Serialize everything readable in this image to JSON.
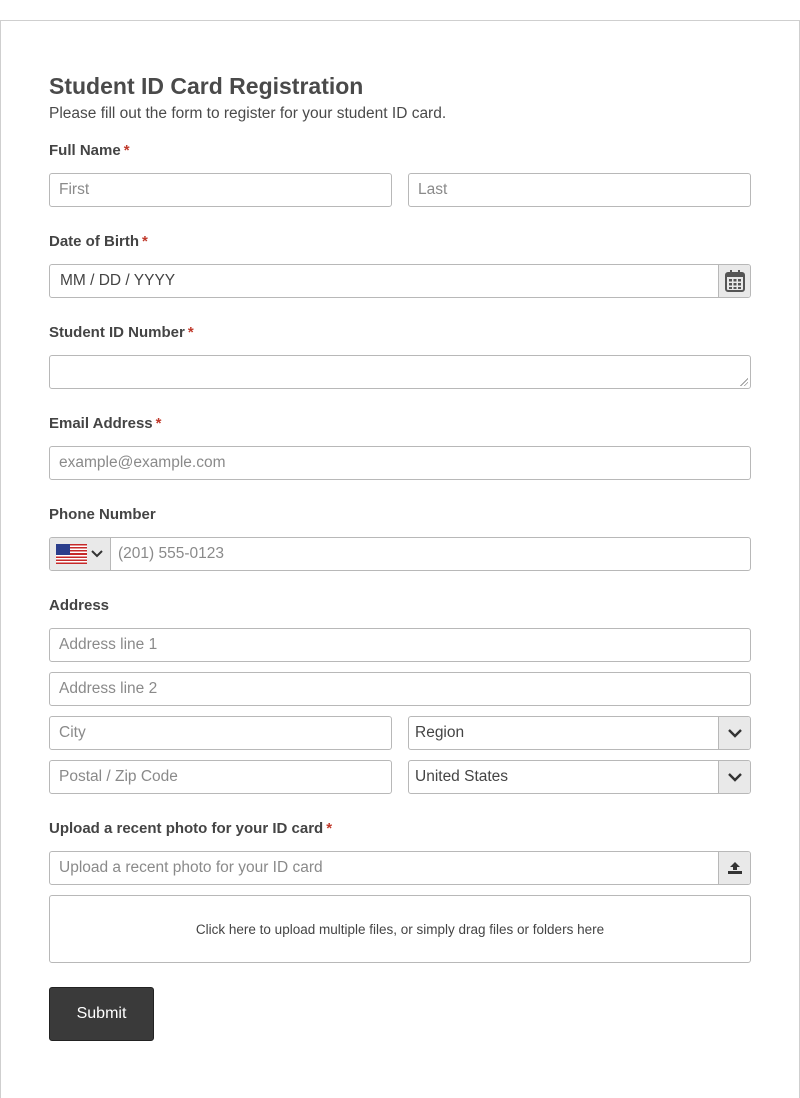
{
  "form": {
    "title": "Student ID Card Registration",
    "description": "Please fill out the form to register for your student ID card.",
    "required_mark": "*",
    "full_name": {
      "label": "Full Name",
      "first_placeholder": "First",
      "last_placeholder": "Last"
    },
    "dob": {
      "label": "Date of Birth",
      "placeholder": "MM / DD / YYYY",
      "icon": "calendar-icon"
    },
    "student_id": {
      "label": "Student ID Number",
      "value": ""
    },
    "email": {
      "label": "Email Address",
      "placeholder": "example@example.com"
    },
    "phone": {
      "label": "Phone Number",
      "country_flag": "us-flag-icon",
      "placeholder": "(201) 555-0123"
    },
    "address": {
      "label": "Address",
      "line1_placeholder": "Address line 1",
      "line2_placeholder": "Address line 2",
      "city_placeholder": "City",
      "region_value": "Region",
      "postal_placeholder": "Postal / Zip Code",
      "country_value": "United States"
    },
    "upload": {
      "label": "Upload a recent photo for your ID card",
      "placeholder": "Upload a recent photo for your ID card",
      "icon": "upload-icon",
      "dropzone_text": "Click here to upload multiple files, or simply drag files or folders here"
    },
    "submit_label": "Submit"
  },
  "colors": {
    "required": "#c0392b",
    "button_bg": "#3a3a3a",
    "border": "#b8b8b8",
    "addon_bg": "#e9e9e9"
  }
}
